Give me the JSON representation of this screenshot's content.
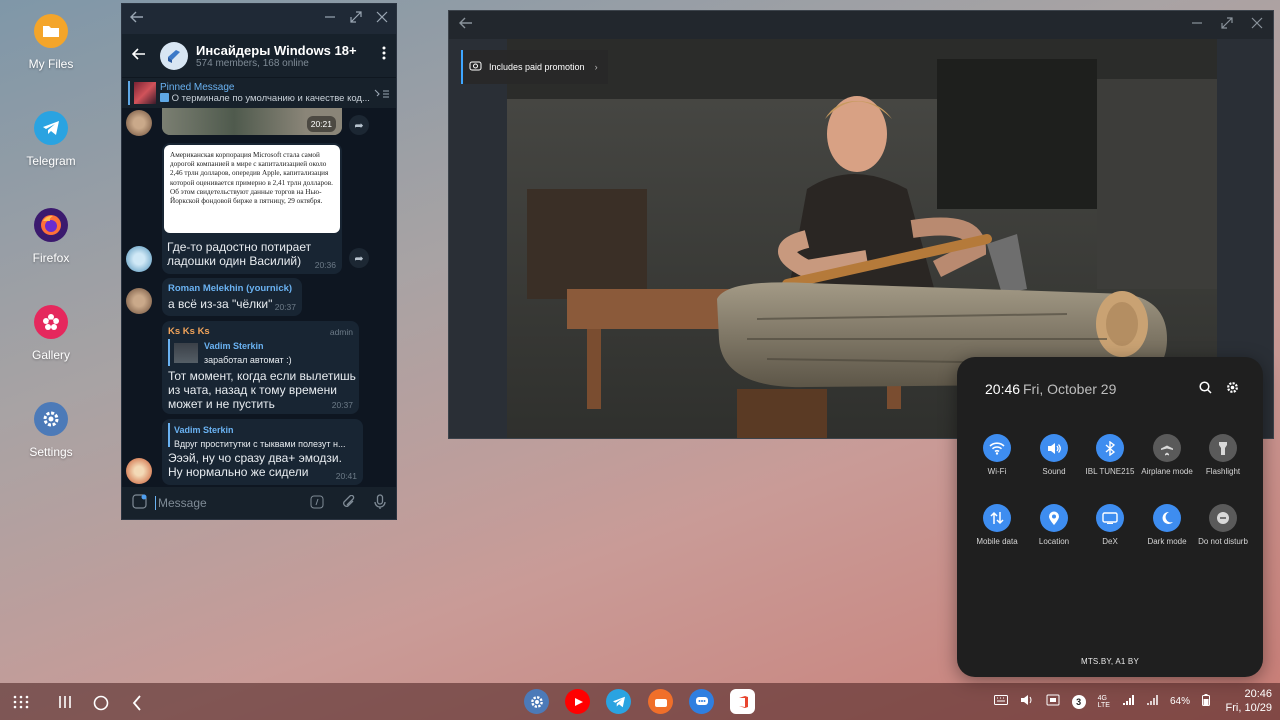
{
  "desktop": {
    "icons": [
      {
        "label": "My Files",
        "color": "#f4a52a"
      },
      {
        "label": "Telegram",
        "color": "#2aa3e1"
      },
      {
        "label": "Firefox",
        "color": "#3b1a6e"
      },
      {
        "label": "Gallery",
        "color": "#e5285d"
      },
      {
        "label": "Settings",
        "color": "#4c7ab8"
      }
    ]
  },
  "telegram": {
    "chat_title": "Инсайдеры Windows 18+",
    "members": "574 members, 168 online",
    "pinned": {
      "title": "Pinned Message",
      "text": "О терминале по умолчанию и качестве код..."
    },
    "messages": [
      {
        "time": "20:21"
      },
      {
        "image_text": "Американская корпорация Microsoft стала самой дорогой компанией в мире с капитализацией около 2,46 трлн долларов, опередив Apple, капитализация которой оценивается примерно в 2,41 трлн долларов. Об этом свидетельствуют данные торгов на Нью-Йоркской фондовой бирже в пятницу, 29 октября.",
        "text": "Где-то радостно потирает ладошки один Василий)",
        "time": "20:36"
      },
      {
        "author": "Roman Melekhin (yournick)",
        "text": "а всё из-за \"чёлки\"",
        "time": "20:37"
      },
      {
        "author": "Ks Ks Ks",
        "role": "admin",
        "reply_author": "Vadim Sterkin",
        "reply_text": "заработал автомат :)",
        "text": "Тот момент, когда если вылетишь из чата, назад к тому времени может и не пустить",
        "time": "20:37"
      },
      {
        "reply_author": "Vadim Sterkin",
        "reply_text": "Вдруг проститутки с тыквами полезут н...",
        "text": "Эээй, ну чо сразу два+ эмодзи. Ну нормально же сидели",
        "time": "20:41"
      }
    ],
    "input_placeholder": "Message"
  },
  "video": {
    "promo_label": "Includes paid promotion"
  },
  "quick_panel": {
    "time": "20:46",
    "date": "Fri, October 29",
    "tiles": [
      {
        "label": "Wi-Fi",
        "on": true,
        "icon": "wifi-icon"
      },
      {
        "label": "Sound",
        "on": true,
        "icon": "sound-icon"
      },
      {
        "label": "IBL TUNE215",
        "on": true,
        "icon": "bluetooth-icon"
      },
      {
        "label": "Airplane mode",
        "on": false,
        "icon": "airplane-icon"
      },
      {
        "label": "Flashlight",
        "on": false,
        "icon": "flashlight-icon"
      },
      {
        "label": "Mobile data",
        "on": true,
        "icon": "mobile-data-icon"
      },
      {
        "label": "Location",
        "on": true,
        "icon": "location-icon"
      },
      {
        "label": "DeX",
        "on": true,
        "icon": "dex-icon"
      },
      {
        "label": "Dark mode",
        "on": true,
        "icon": "moon-icon"
      },
      {
        "label": "Do not disturb",
        "on": false,
        "icon": "dnd-icon"
      }
    ],
    "carrier": "MTS.BY, A1 BY",
    "accent": "#3e8df0"
  },
  "taskbar": {
    "battery": "64%",
    "notifications_count": "3",
    "clock_time": "20:46",
    "clock_date": "Fri, 10/29"
  }
}
